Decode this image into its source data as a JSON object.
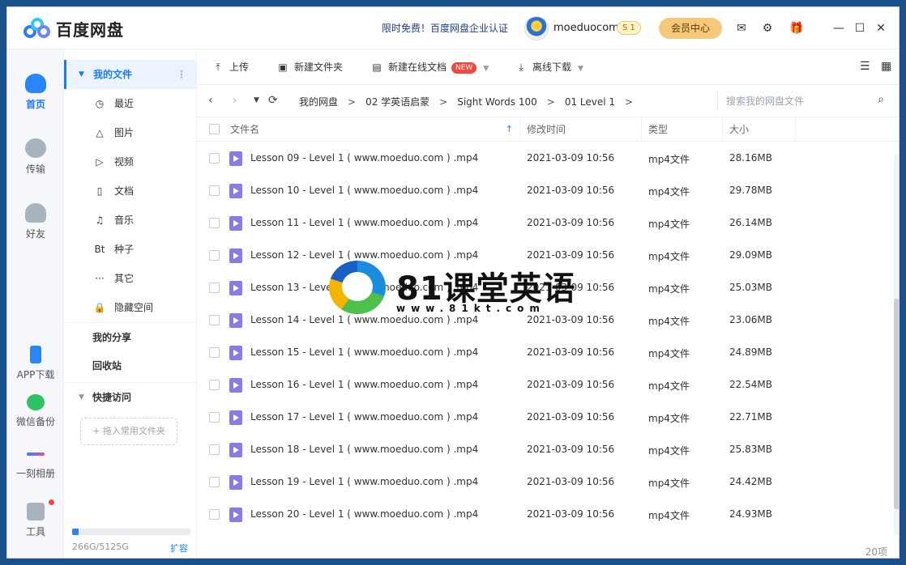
{
  "app": {
    "title": "百度网盘"
  },
  "header": {
    "promo": "限时免费！百度网盘企业认证",
    "username": "moeduocom",
    "vip_badge": "S 1",
    "member_center": "会员中心"
  },
  "leftnav": {
    "home": "首页",
    "transfer": "传输",
    "friends": "好友",
    "app_download": "APP下载",
    "wechat_backup": "微信备份",
    "album": "一刻相册",
    "tools": "工具"
  },
  "sidebar": {
    "my_files": "我的文件",
    "items": [
      {
        "icon": "clock-icon",
        "glyph": "◷",
        "label": "最近"
      },
      {
        "icon": "image-icon",
        "glyph": "△",
        "label": "图片"
      },
      {
        "icon": "video-icon",
        "glyph": "▷",
        "label": "视频"
      },
      {
        "icon": "document-icon",
        "glyph": "▯",
        "label": "文档"
      },
      {
        "icon": "headphone-icon",
        "glyph": "♫",
        "label": "音乐"
      },
      {
        "icon": "torrent-icon",
        "glyph": "Bt",
        "label": "种子"
      },
      {
        "icon": "more-icon",
        "glyph": "···",
        "label": "其它"
      },
      {
        "icon": "lock-icon",
        "glyph": "🔒",
        "label": "隐藏空间"
      }
    ],
    "my_share": "我的分享",
    "recycle_bin": "回收站",
    "quick_access": "快捷访问",
    "drop_hint": "+ 拖入常用文件夹",
    "storage_text": "266G/5125G",
    "storage_fraction": 0.052,
    "expand": "扩容"
  },
  "toolbar": {
    "upload": "上传",
    "new_folder": "新建文件夹",
    "new_online_doc": "新建在线文档",
    "new_tag": "NEW",
    "offline_download": "离线下载"
  },
  "path": {
    "crumbs": [
      "我的网盘",
      "02 学英语启蒙",
      "Sight Words 100",
      "01 Level 1"
    ],
    "search_placeholder": "搜索我的网盘文件"
  },
  "table": {
    "headers": {
      "name": "文件名",
      "modified": "修改时间",
      "type": "类型",
      "size": "大小"
    },
    "rows": [
      {
        "name": "Lesson 09 - Level 1 ( www.moeduo.com ) .mp4",
        "modified": "2021-03-09 10:56",
        "type": "mp4文件",
        "size": "28.16MB"
      },
      {
        "name": "Lesson 10 - Level 1 ( www.moeduo.com ) .mp4",
        "modified": "2021-03-09 10:56",
        "type": "mp4文件",
        "size": "29.78MB"
      },
      {
        "name": "Lesson 11 - Level 1 ( www.moeduo.com ) .mp4",
        "modified": "2021-03-09 10:56",
        "type": "mp4文件",
        "size": "26.14MB"
      },
      {
        "name": "Lesson 12 - Level 1 ( www.moeduo.com ) .mp4",
        "modified": "2021-03-09 10:56",
        "type": "mp4文件",
        "size": "29.09MB"
      },
      {
        "name": "Lesson 13 - Level 1 ( www.moeduo.com ) .mp4",
        "modified": "2021-03-09 10:56",
        "type": "mp4文件",
        "size": "25.03MB"
      },
      {
        "name": "Lesson 14 - Level 1 ( www.moeduo.com ) .mp4",
        "modified": "2021-03-09 10:56",
        "type": "mp4文件",
        "size": "23.06MB"
      },
      {
        "name": "Lesson 15 - Level 1 ( www.moeduo.com ) .mp4",
        "modified": "2021-03-09 10:56",
        "type": "mp4文件",
        "size": "24.89MB"
      },
      {
        "name": "Lesson 16 - Level 1 ( www.moeduo.com ) .mp4",
        "modified": "2021-03-09 10:56",
        "type": "mp4文件",
        "size": "22.54MB"
      },
      {
        "name": "Lesson 17 - Level 1 ( www.moeduo.com ) .mp4",
        "modified": "2021-03-09 10:56",
        "type": "mp4文件",
        "size": "22.71MB"
      },
      {
        "name": "Lesson 18 - Level 1 ( www.moeduo.com ) .mp4",
        "modified": "2021-03-09 10:56",
        "type": "mp4文件",
        "size": "25.83MB"
      },
      {
        "name": "Lesson 19 - Level 1 ( www.moeduo.com ) .mp4",
        "modified": "2021-03-09 10:56",
        "type": "mp4文件",
        "size": "24.42MB"
      },
      {
        "name": "Lesson 20 - Level 1 ( www.moeduo.com ) .mp4",
        "modified": "2021-03-09 10:56",
        "type": "mp4文件",
        "size": "24.93MB"
      }
    ],
    "count": "20项"
  },
  "watermark": {
    "title": "81课堂英语",
    "url": "www.81kt.com"
  },
  "colors": {
    "accent": "#1c7cf5",
    "member": "#f6c97a",
    "new_tag": "#f0473f",
    "file_icon": "#8b79e8"
  }
}
